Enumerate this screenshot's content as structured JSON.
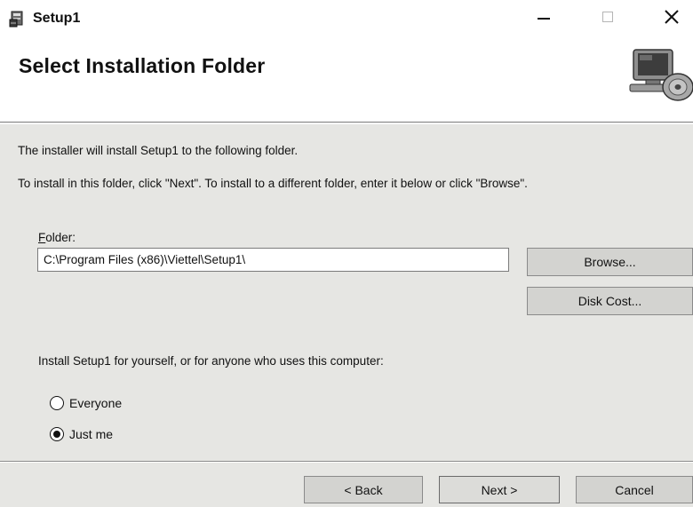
{
  "window": {
    "title": "Setup1",
    "icons": {
      "app": "installer-icon",
      "minimize": "minimize-icon",
      "maximize": "maximize-icon",
      "close": "close-icon"
    }
  },
  "banner": {
    "title": "Select Installation Folder",
    "icon": "computer-disc-icon"
  },
  "body": {
    "line1": "The installer will install Setup1 to the following folder.",
    "line2": "To install in this folder, click \"Next\". To install to a different folder, enter it below or click \"Browse\".",
    "folder_label_accel": "F",
    "folder_label_rest": "older:",
    "folder_value": "C:\\Program Files (x86)\\Viettel\\Setup1\\",
    "browse_label": "Browse...",
    "disk_cost_label": "Disk Cost...",
    "install_for_text": "Install Setup1 for yourself, or for anyone who uses this computer:",
    "radio_options": [
      {
        "label": "Everyone",
        "selected": false
      },
      {
        "label": "Just me",
        "selected": true
      }
    ]
  },
  "footer": {
    "back_label": "< Back",
    "next_label": "Next >",
    "cancel_label": "Cancel"
  }
}
